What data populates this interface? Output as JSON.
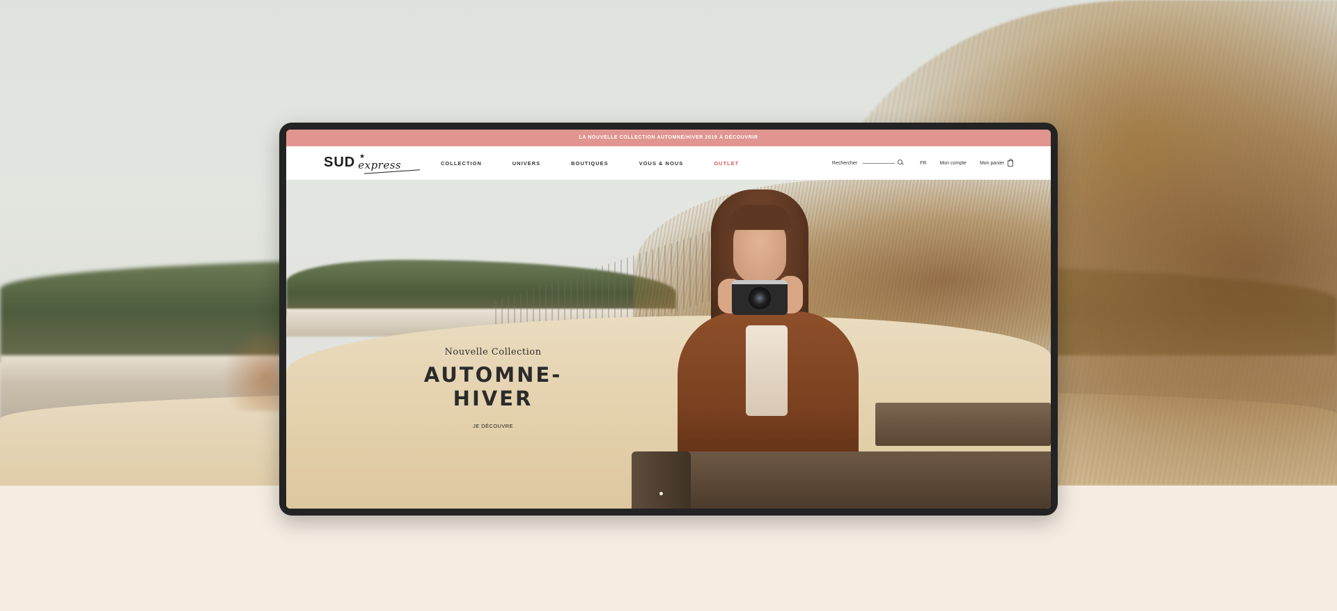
{
  "promo_bar": {
    "text": "LA NOUVELLE COLLECTION AUTOMNE/HIVER 2019 À DÉCOUVRIR"
  },
  "logo": {
    "main": "SUD",
    "star": "★",
    "script": "express"
  },
  "nav": {
    "items": [
      {
        "label": "COLLECTION"
      },
      {
        "label": "UNIVERS"
      },
      {
        "label": "BOUTIQUES"
      },
      {
        "label": "VOUS & NOUS"
      },
      {
        "label": "OUTLET"
      }
    ]
  },
  "tools": {
    "search_label": "Rechercher",
    "language": "FR",
    "account": "Mon compte",
    "cart": "Mon panier"
  },
  "hero": {
    "eyebrow": "Nouvelle Collection",
    "title": "AUTOMNE-HIVER",
    "cta": "JE DÉCOUVRE"
  },
  "colors": {
    "promo_bar": "#e09590",
    "outlet": "#d65a4e",
    "page_background": "#f5ece2",
    "device_frame": "#232323"
  }
}
